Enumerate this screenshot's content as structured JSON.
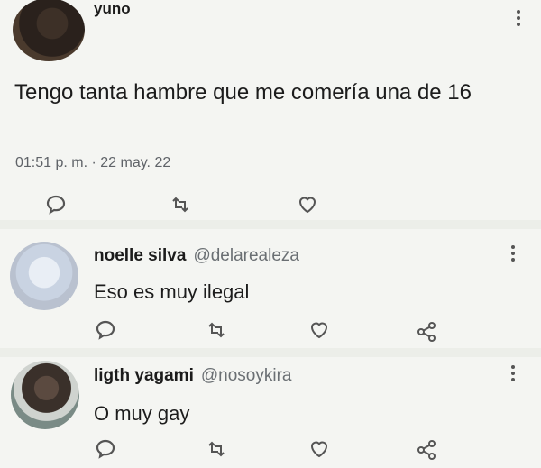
{
  "main_tweet": {
    "author": "yuno",
    "text": "Tengo tanta hambre que me comería una de 16",
    "timestamp": "01:51 p. m. · 22 may. 22",
    "icons": [
      "reply-icon",
      "retweet-icon",
      "like-icon"
    ]
  },
  "replies": [
    {
      "name": "noelle silva",
      "handle": "@delarealeza",
      "text": "Eso es muy ilegal",
      "icons": [
        "reply-icon",
        "retweet-icon",
        "like-icon",
        "share-icon"
      ]
    },
    {
      "name": "ligth yagami",
      "handle": "@nosoykira",
      "text": "O muy gay",
      "icons": [
        "reply-icon",
        "retweet-icon",
        "like-icon",
        "share-icon"
      ]
    }
  ],
  "colors": {
    "background": "#f4f5f2",
    "text": "#1c1c1c",
    "muted": "#6a6f73",
    "icon": "#555555"
  }
}
